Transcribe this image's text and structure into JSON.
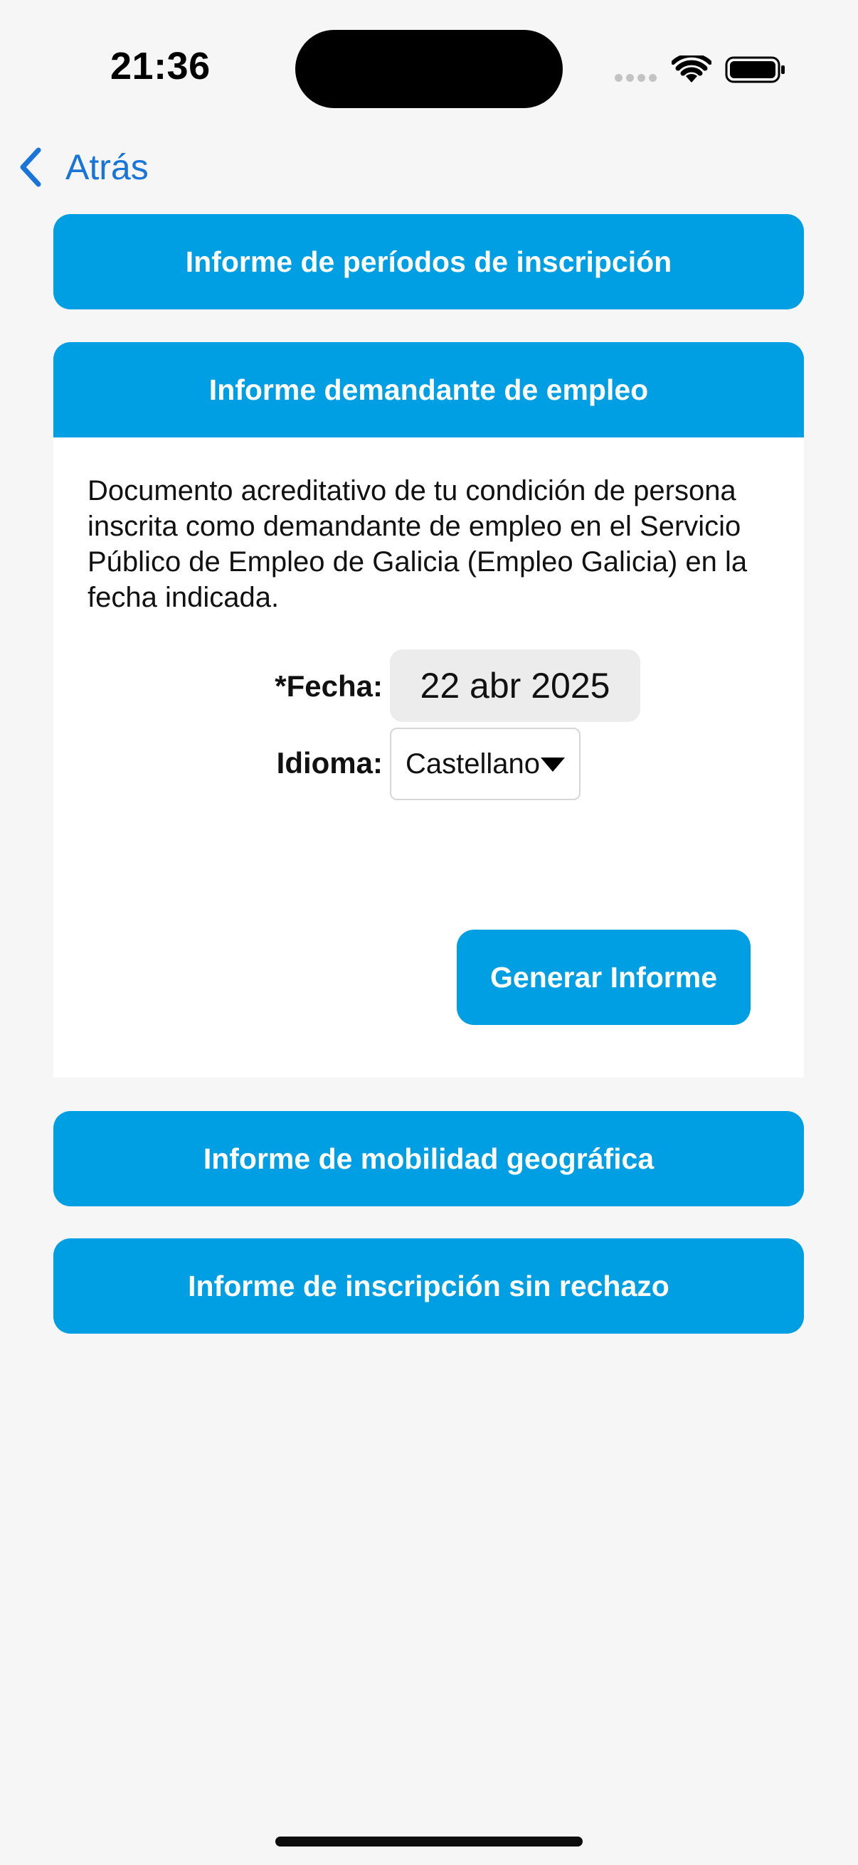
{
  "status_bar": {
    "time": "21:36"
  },
  "nav": {
    "back_label": "Atrás"
  },
  "sections": [
    {
      "label": "Informe de períodos de inscripción"
    },
    {
      "label": "Informe demandante de empleo"
    },
    {
      "label": "Informe de mobilidad geográfica"
    },
    {
      "label": "Informe de inscripción sin rechazo"
    }
  ],
  "panel": {
    "description": "Documento acreditativo de tu condición de persona inscrita como demandante de empleo en el Servicio Público de Empleo de Galicia (Empleo Galicia) en la fecha indicada.",
    "date_label": "*Fecha:",
    "date_value": "22 abr 2025",
    "language_label": "Idioma:",
    "language_value": "Castellano",
    "generate_label": "Generar Informe"
  },
  "colors": {
    "accent": "#009fe3",
    "link": "#1976d8",
    "background": "#f6f6f6"
  },
  "icons": {
    "back": "chevron-left-icon",
    "wifi": "wifi-icon",
    "battery": "battery-icon",
    "select": "caret-down-icon"
  }
}
